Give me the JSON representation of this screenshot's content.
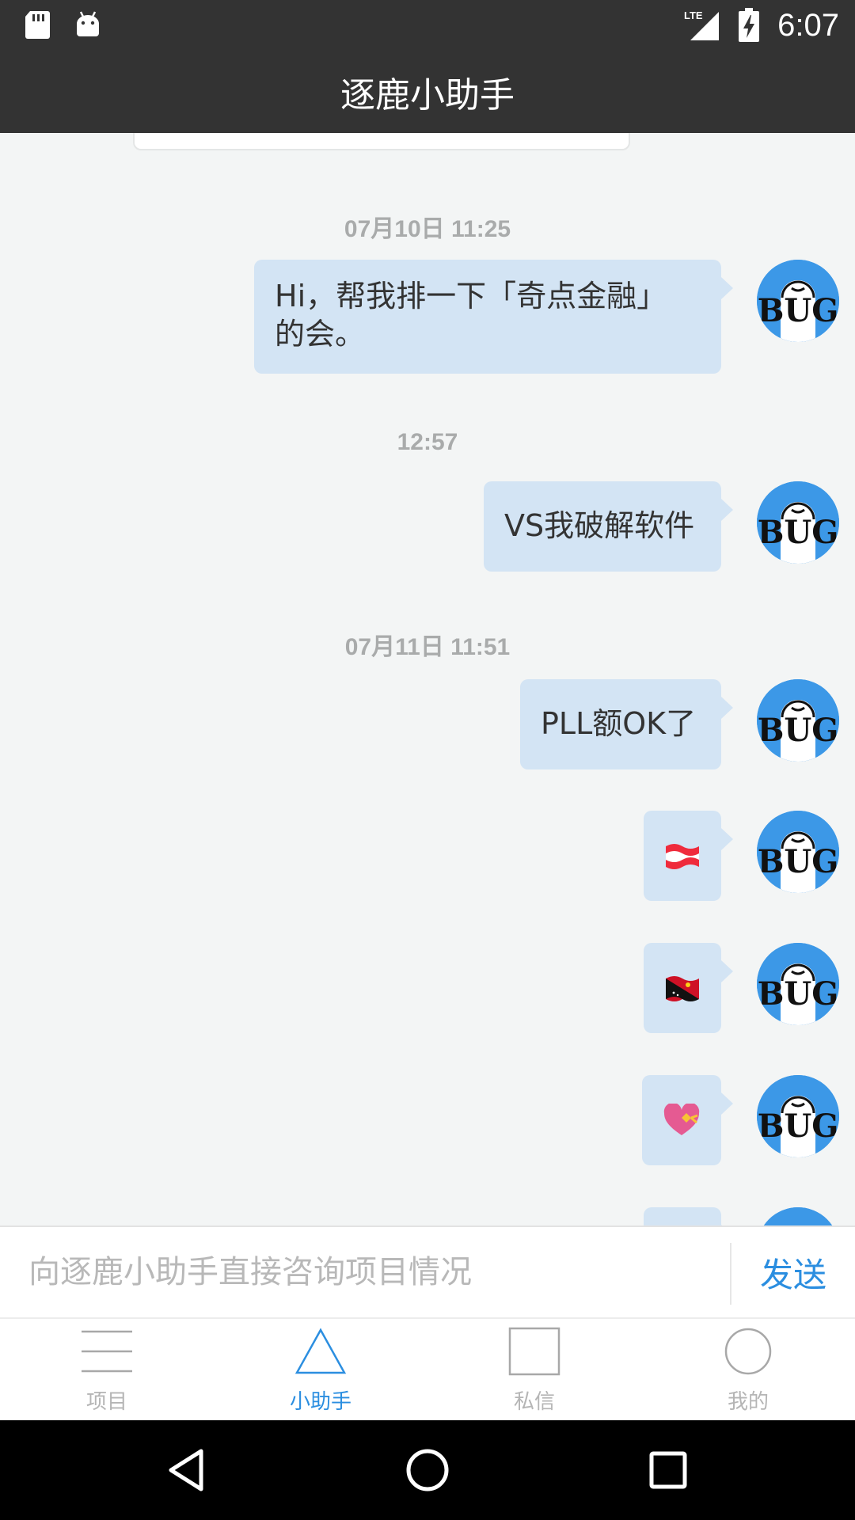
{
  "status_bar": {
    "time": "6:07",
    "network": "LTE",
    "left_icons": [
      "sd-card-icon",
      "android-icon"
    ],
    "right_icons": [
      "lte-signal-icon",
      "battery-charging-icon"
    ]
  },
  "header": {
    "title": "逐鹿小助手"
  },
  "chat": {
    "timestamps": [
      "07月10日 11:25",
      "12:57",
      "07月11日 11:51"
    ],
    "messages": [
      {
        "type": "text",
        "line1": "Hi，帮我排一下「奇点金融」",
        "line2": "的会。"
      },
      {
        "type": "text",
        "text": "VS我破解软件"
      },
      {
        "type": "text",
        "text": "PLL额OK了"
      },
      {
        "type": "emoji",
        "emoji": "🇦🇹",
        "icon": "austria-flag-emoji"
      },
      {
        "type": "emoji",
        "emoji": "🇵🇬",
        "icon": "papua-new-guinea-flag-emoji"
      },
      {
        "type": "emoji",
        "emoji": "💝",
        "icon": "heart-with-ribbon-emoji"
      }
    ],
    "avatar_text": "BUG"
  },
  "composer": {
    "placeholder": "向逐鹿小助手直接咨询项目情况",
    "value": "",
    "send_label": "发送"
  },
  "tabs": [
    {
      "label": "项目",
      "icon": "menu-lines-icon",
      "active": false
    },
    {
      "label": "小助手",
      "icon": "triangle-icon",
      "active": true
    },
    {
      "label": "私信",
      "icon": "square-icon",
      "active": false
    },
    {
      "label": "我的",
      "icon": "circle-icon",
      "active": false
    }
  ],
  "nav_bar": {
    "buttons": [
      "back-icon",
      "home-icon",
      "recents-icon"
    ]
  },
  "colors": {
    "bar_dark": "#333333",
    "bubble": "#d3e4f4",
    "accent": "#2b8ee0",
    "chat_bg": "#f3f5f5",
    "avatar_blue": "#3c98e7"
  }
}
